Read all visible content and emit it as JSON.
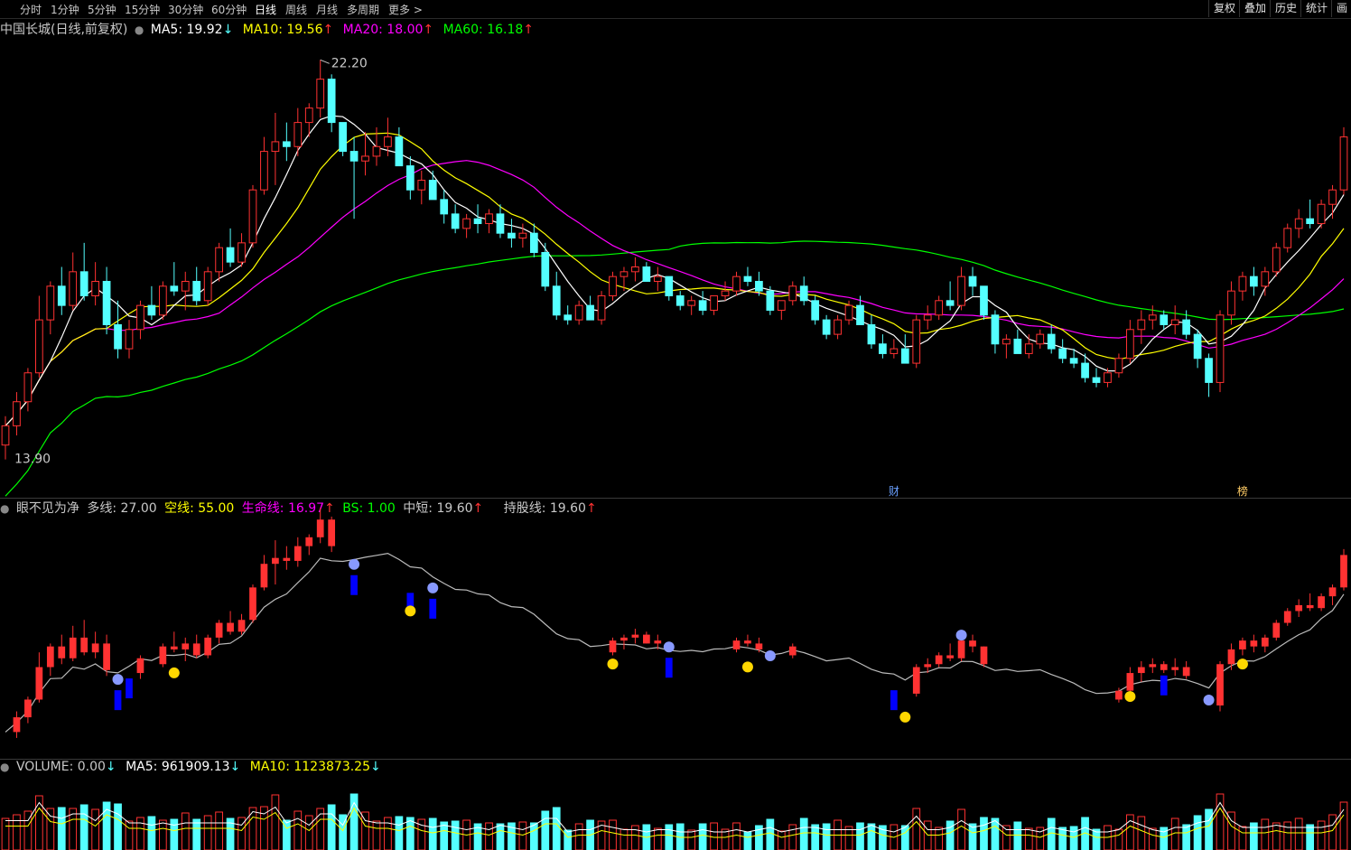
{
  "toolbar": {
    "periods": [
      "分时",
      "1分钟",
      "5分钟",
      "15分钟",
      "30分钟",
      "60分钟",
      "日线",
      "周线",
      "月线",
      "多周期",
      "更多 >"
    ],
    "active": "日线",
    "right_buttons": [
      "复权",
      "叠加",
      "历史",
      "统计",
      "画"
    ]
  },
  "main_legend": {
    "stock": "中国长城(日线,前复权)",
    "ma5": "MA5: 19.92",
    "ma5_arrow": "↓",
    "ma10": "MA10: 19.56",
    "ma10_arrow": "↑",
    "ma20": "MA20: 18.00",
    "ma20_arrow": "↑",
    "ma60": "MA60: 16.18",
    "ma60_arrow": "↑"
  },
  "main_annotations": {
    "high_label": "22.20",
    "low_label": "13.90",
    "marker_cai": "财",
    "marker_bang": "榜"
  },
  "indicator_legend": {
    "name": "眼不见为净",
    "duo": "多线: 27.00",
    "kong": "空线: 55.00",
    "life": "生命线: 16.97",
    "life_arrow": "↑",
    "bs": "BS: 1.00",
    "zhongduan": "中短: 19.60",
    "zhongduan_arrow": "↑",
    "chigu": "持股线: 19.60",
    "chigu_arrow": "↑"
  },
  "volume_legend": {
    "volume": "VOLUME: 0.00",
    "volume_arrow": "↓",
    "ma5": "MA5: 961909.13",
    "ma5_arrow": "↓",
    "ma10": "MA10: 1123873.25",
    "ma10_arrow": "↓"
  },
  "colors": {
    "up": "#ff3232",
    "down": "#54ffff",
    "ma5": "#ffffff",
    "ma10": "#ffff00",
    "ma20": "#ff00ff",
    "ma60": "#00ff00",
    "blue_bar": "#0000ff",
    "smile": "#ffd700"
  },
  "chart_data": {
    "type": "candlestick",
    "title": "中国长城(日线,前复权)",
    "ylim": [
      13.5,
      22.6
    ],
    "candles": [
      [
        14.2,
        14.8,
        13.9,
        14.6
      ],
      [
        14.6,
        15.3,
        14.4,
        15.1
      ],
      [
        15.1,
        15.8,
        14.9,
        15.7
      ],
      [
        15.7,
        17.3,
        15.6,
        16.8
      ],
      [
        16.8,
        17.6,
        16.5,
        17.5
      ],
      [
        17.5,
        17.9,
        16.9,
        17.1
      ],
      [
        17.1,
        18.2,
        17.0,
        17.8
      ],
      [
        17.8,
        18.4,
        17.2,
        17.3
      ],
      [
        17.3,
        18.0,
        17.1,
        17.6
      ],
      [
        17.6,
        17.9,
        16.5,
        16.7
      ],
      [
        16.7,
        17.2,
        16.0,
        16.2
      ],
      [
        16.2,
        16.8,
        16.0,
        16.6
      ],
      [
        16.6,
        17.2,
        16.4,
        17.1
      ],
      [
        17.1,
        17.5,
        16.8,
        16.9
      ],
      [
        16.9,
        17.6,
        16.8,
        17.5
      ],
      [
        17.5,
        18.0,
        17.3,
        17.4
      ],
      [
        17.4,
        17.8,
        17.0,
        17.6
      ],
      [
        17.6,
        17.9,
        17.1,
        17.2
      ],
      [
        17.2,
        17.9,
        17.1,
        17.8
      ],
      [
        17.8,
        18.4,
        17.6,
        18.3
      ],
      [
        18.3,
        18.7,
        17.9,
        18.0
      ],
      [
        18.0,
        18.6,
        17.9,
        18.4
      ],
      [
        18.4,
        19.6,
        18.3,
        19.5
      ],
      [
        19.5,
        20.6,
        19.4,
        20.3
      ],
      [
        20.3,
        21.1,
        19.6,
        20.5
      ],
      [
        20.5,
        20.9,
        20.1,
        20.4
      ],
      [
        20.4,
        21.2,
        20.2,
        20.9
      ],
      [
        20.9,
        21.3,
        20.6,
        21.2
      ],
      [
        21.2,
        22.2,
        21.0,
        21.8
      ],
      [
        21.8,
        21.9,
        20.7,
        20.9
      ],
      [
        20.9,
        20.9,
        20.2,
        20.3
      ],
      [
        20.3,
        20.6,
        18.9,
        20.1
      ],
      [
        20.1,
        20.7,
        19.8,
        20.2
      ],
      [
        20.2,
        20.8,
        20.0,
        20.4
      ],
      [
        20.4,
        21.0,
        20.2,
        20.6
      ],
      [
        20.6,
        20.8,
        20.1,
        20.0
      ],
      [
        20.0,
        20.2,
        19.3,
        19.5
      ],
      [
        19.5,
        19.9,
        19.2,
        19.7
      ],
      [
        19.7,
        19.9,
        19.3,
        19.3
      ],
      [
        19.3,
        19.5,
        18.8,
        19.0
      ],
      [
        19.0,
        19.2,
        18.6,
        18.7
      ],
      [
        18.7,
        19.0,
        18.5,
        18.9
      ],
      [
        18.9,
        19.2,
        18.6,
        18.8
      ],
      [
        18.8,
        19.1,
        18.6,
        19.0
      ],
      [
        19.0,
        19.2,
        18.5,
        18.6
      ],
      [
        18.6,
        18.9,
        18.3,
        18.5
      ],
      [
        18.5,
        18.8,
        18.3,
        18.6
      ],
      [
        18.6,
        18.8,
        18.1,
        18.2
      ],
      [
        18.2,
        18.4,
        17.4,
        17.5
      ],
      [
        17.5,
        17.8,
        16.8,
        16.9
      ],
      [
        16.9,
        17.1,
        16.7,
        16.8
      ],
      [
        16.8,
        17.2,
        16.7,
        17.1
      ],
      [
        17.1,
        17.3,
        16.8,
        16.8
      ],
      [
        16.8,
        17.4,
        16.7,
        17.3
      ],
      [
        17.3,
        17.8,
        17.2,
        17.7
      ],
      [
        17.7,
        17.9,
        17.4,
        17.8
      ],
      [
        17.8,
        18.1,
        17.6,
        17.9
      ],
      [
        17.9,
        18.0,
        17.6,
        17.6
      ],
      [
        17.6,
        17.9,
        17.4,
        17.7
      ],
      [
        17.7,
        17.7,
        17.2,
        17.3
      ],
      [
        17.3,
        17.4,
        17.0,
        17.1
      ],
      [
        17.1,
        17.3,
        16.9,
        17.2
      ],
      [
        17.2,
        17.4,
        16.9,
        17.0
      ],
      [
        17.0,
        17.3,
        16.9,
        17.3
      ],
      [
        17.3,
        17.6,
        17.2,
        17.4
      ],
      [
        17.4,
        17.8,
        17.3,
        17.7
      ],
      [
        17.7,
        17.9,
        17.5,
        17.6
      ],
      [
        17.6,
        17.8,
        17.3,
        17.4
      ],
      [
        17.4,
        17.5,
        16.9,
        17.0
      ],
      [
        17.0,
        17.2,
        16.8,
        17.2
      ],
      [
        17.2,
        17.6,
        17.1,
        17.5
      ],
      [
        17.5,
        17.7,
        17.1,
        17.2
      ],
      [
        17.2,
        17.3,
        16.7,
        16.8
      ],
      [
        16.8,
        16.9,
        16.4,
        16.5
      ],
      [
        16.5,
        16.9,
        16.4,
        16.8
      ],
      [
        16.8,
        17.2,
        16.7,
        17.1
      ],
      [
        17.1,
        17.3,
        16.8,
        16.7
      ],
      [
        16.7,
        16.9,
        16.2,
        16.3
      ],
      [
        16.3,
        16.5,
        16.0,
        16.1
      ],
      [
        16.1,
        16.4,
        16.0,
        16.2
      ],
      [
        16.2,
        16.5,
        15.9,
        15.9
      ],
      [
        15.9,
        16.9,
        15.8,
        16.8
      ],
      [
        16.8,
        17.1,
        16.6,
        16.9
      ],
      [
        16.9,
        17.3,
        16.8,
        17.2
      ],
      [
        17.2,
        17.6,
        17.0,
        17.1
      ],
      [
        17.1,
        17.9,
        17.0,
        17.7
      ],
      [
        17.7,
        17.9,
        17.3,
        17.5
      ],
      [
        17.5,
        17.5,
        16.8,
        16.9
      ],
      [
        16.9,
        17.0,
        16.1,
        16.3
      ],
      [
        16.3,
        16.5,
        16.0,
        16.4
      ],
      [
        16.4,
        16.6,
        16.1,
        16.1
      ],
      [
        16.1,
        16.5,
        16.0,
        16.3
      ],
      [
        16.3,
        16.6,
        16.2,
        16.5
      ],
      [
        16.5,
        16.7,
        16.1,
        16.2
      ],
      [
        16.2,
        16.4,
        15.9,
        16.0
      ],
      [
        16.0,
        16.2,
        15.8,
        15.9
      ],
      [
        15.9,
        16.1,
        15.5,
        15.6
      ],
      [
        15.6,
        15.8,
        15.4,
        15.5
      ],
      [
        15.5,
        15.8,
        15.4,
        15.7
      ],
      [
        15.7,
        16.1,
        15.6,
        16.0
      ],
      [
        16.0,
        16.8,
        15.9,
        16.6
      ],
      [
        16.6,
        17.0,
        16.3,
        16.8
      ],
      [
        16.8,
        17.1,
        16.6,
        16.9
      ],
      [
        16.9,
        17.0,
        16.6,
        16.7
      ],
      [
        16.7,
        17.1,
        16.5,
        16.8
      ],
      [
        16.8,
        17.0,
        16.4,
        16.5
      ],
      [
        16.5,
        16.6,
        15.8,
        16.0
      ],
      [
        16.0,
        16.1,
        15.2,
        15.5
      ],
      [
        15.5,
        17.0,
        15.3,
        16.9
      ],
      [
        16.9,
        17.6,
        16.7,
        17.4
      ],
      [
        17.4,
        17.8,
        17.2,
        17.7
      ],
      [
        17.7,
        17.9,
        17.3,
        17.5
      ],
      [
        17.5,
        17.9,
        17.3,
        17.8
      ],
      [
        17.8,
        18.4,
        17.7,
        18.3
      ],
      [
        18.3,
        18.8,
        18.2,
        18.7
      ],
      [
        18.7,
        19.1,
        18.5,
        18.9
      ],
      [
        18.9,
        19.3,
        18.7,
        18.8
      ],
      [
        18.8,
        19.3,
        18.7,
        19.2
      ],
      [
        19.2,
        19.6,
        18.9,
        19.5
      ],
      [
        19.5,
        20.8,
        19.4,
        20.6
      ]
    ],
    "series": [
      {
        "name": "MA5"
      },
      {
        "name": "MA10"
      },
      {
        "name": "MA20"
      },
      {
        "name": "MA60"
      }
    ]
  }
}
